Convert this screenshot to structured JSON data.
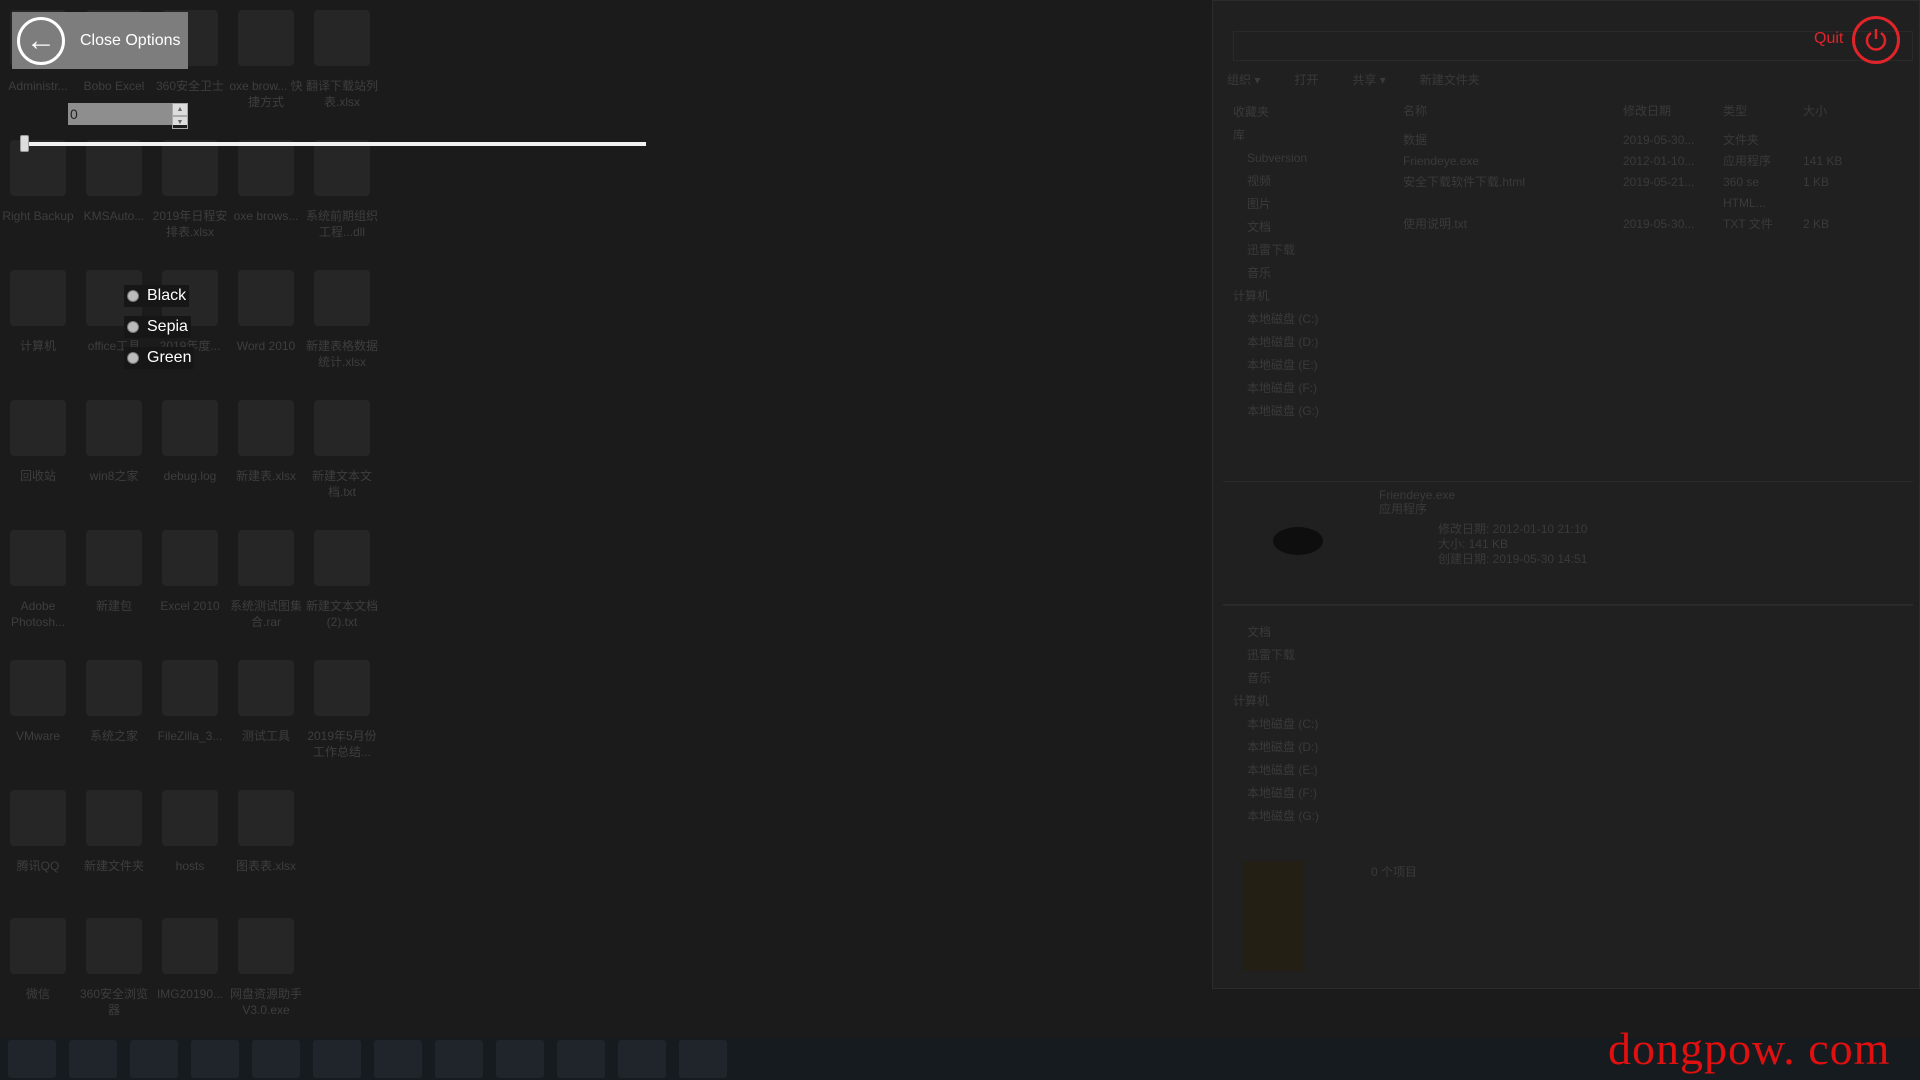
{
  "options_panel": {
    "close_label": "Close Options",
    "spin_value": "0",
    "slider_value_percent": 0,
    "themes": [
      "Black",
      "Sepia",
      "Green"
    ],
    "quit_label": "Quit",
    "accent_color": "#e0242a"
  },
  "desktop": {
    "icons": [
      [
        "Administr...",
        "Bobo Excel",
        "360安全卫士",
        "oxe brow... 快捷方式",
        "翻译下载站列表.xlsx"
      ],
      [
        "Right Backup",
        "KMSAuto...",
        "2019年日程安排表.xlsx",
        "oxe brows...",
        "系统前期组织工程...dll"
      ],
      [
        "计算机",
        "office工具",
        "2019年度...",
        "Word 2010",
        "新建表格数据统计.xlsx"
      ],
      [
        "回收站",
        "win8之家",
        "debug.log",
        "新建表.xlsx",
        "新建文本文档.txt"
      ],
      [
        "Adobe Photosh...",
        "新建包",
        "Excel 2010",
        "系统测试图集合.rar",
        "新建文本文档(2).txt"
      ],
      [
        "VMware",
        "系统之家",
        "FileZilla_3...",
        "测试工具",
        "2019年5月份工作总结..."
      ],
      [
        "腾讯QQ",
        "新建文件夹",
        "hosts",
        "图表表.xlsx"
      ],
      [
        "微信",
        "360安全浏览器",
        "IMG20190...",
        "网盘资源助手V3.0.exe"
      ]
    ]
  },
  "explorer": {
    "toolbar": [
      "组织 ▾",
      "打开",
      "共享 ▾",
      "新建文件夹"
    ],
    "nav": [
      "收藏夹",
      "库",
      "Subversion",
      "视频",
      "图片",
      "文档",
      "迅雷下载",
      "音乐",
      "计算机",
      "本地磁盘 (C:)",
      "本地磁盘 (D:)",
      "本地磁盘 (E:)",
      "本地磁盘 (F:)",
      "本地磁盘 (G:)"
    ],
    "columns": [
      "名称",
      "修改日期",
      "类型",
      "大小"
    ],
    "files": [
      [
        "数据",
        "2019-05-30...",
        "文件夹",
        ""
      ],
      [
        "Friendeye.exe",
        "2012-01-10...",
        "应用程序",
        "141 KB"
      ],
      [
        "安全下载软件下载.html",
        "2019-05-21...",
        "360 se HTML...",
        "1 KB"
      ],
      [
        "使用说明.txt",
        "2019-05-30...",
        "TXT 文件",
        "2 KB"
      ]
    ],
    "detail": {
      "name": "Friendeye.exe",
      "type": "应用程序",
      "modified": "修改日期: 2012-01-10 21:10",
      "size": "大小: 141 KB",
      "created": "创建日期: 2019-05-30 14:51"
    },
    "nav2": [
      "文档",
      "迅雷下载",
      "音乐",
      "计算机",
      "本地磁盘 (C:)",
      "本地磁盘 (D:)",
      "本地磁盘 (E:)",
      "本地磁盘 (F:)",
      "本地磁盘 (G:)"
    ],
    "status": "0 个项目"
  },
  "watermark": "dongpow. com"
}
